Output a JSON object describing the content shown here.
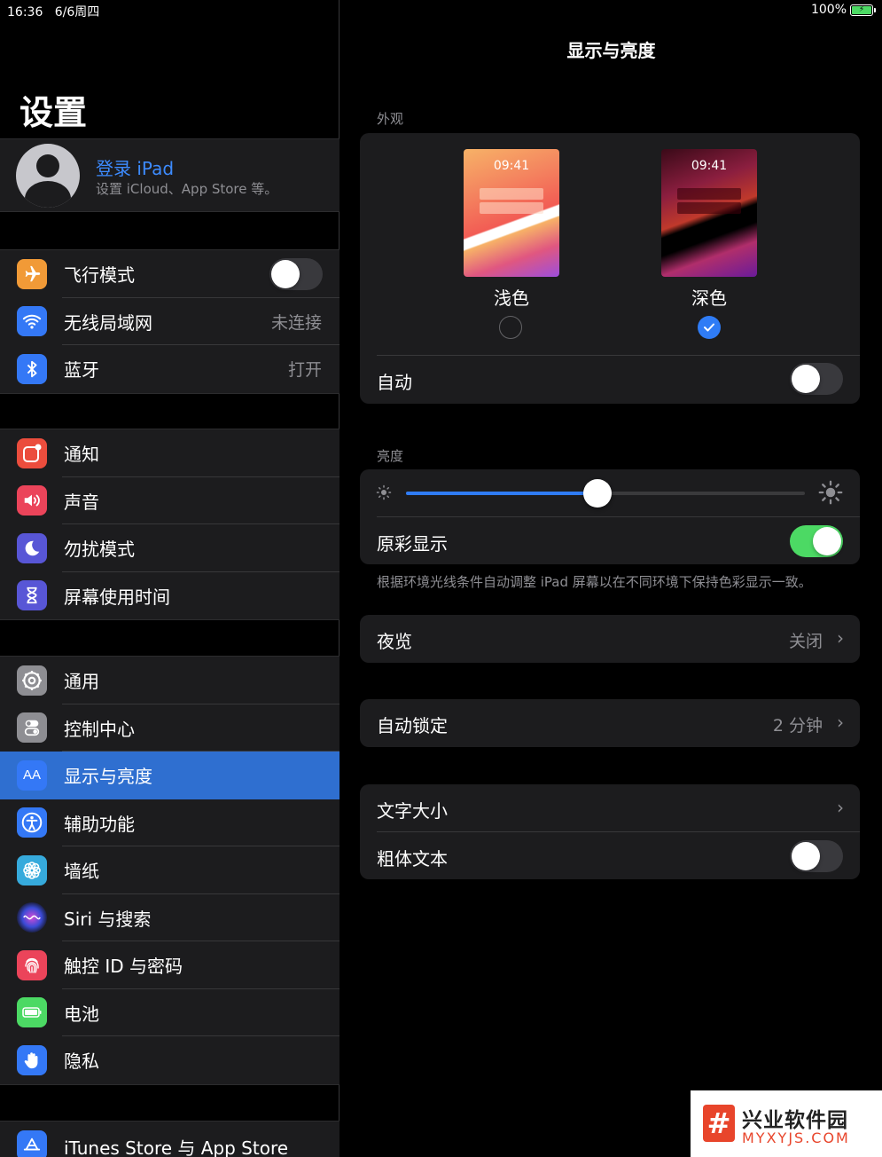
{
  "status": {
    "time": "16:36",
    "date": "6/6周四",
    "battery": "100%"
  },
  "sidebar": {
    "title": "设置",
    "profile": {
      "name": "登录 iPad",
      "subtitle": "设置 iCloud、App Store 等。"
    },
    "group1": [
      {
        "label": "飞行模式",
        "icon": "airplane-icon",
        "color": "#f19a37"
      },
      {
        "label": "无线局域网",
        "value": "未连接",
        "icon": "wifi-icon",
        "color": "#3478f6"
      },
      {
        "label": "蓝牙",
        "value": "打开",
        "icon": "bluetooth-icon",
        "color": "#3478f6"
      }
    ],
    "group2": [
      {
        "label": "通知",
        "icon": "notifications-icon",
        "color": "#eb4d3d"
      },
      {
        "label": "声音",
        "icon": "sound-icon",
        "color": "#eb445a"
      },
      {
        "label": "勿扰模式",
        "icon": "moon-icon",
        "color": "#5856d6"
      },
      {
        "label": "屏幕使用时间",
        "icon": "hourglass-icon",
        "color": "#5856d6"
      }
    ],
    "group3": [
      {
        "label": "通用",
        "icon": "gear-icon",
        "color": "#8e8e93"
      },
      {
        "label": "控制中心",
        "icon": "switches-icon",
        "color": "#8e8e93"
      },
      {
        "label": "显示与亮度",
        "icon": "text-size-icon",
        "color": "#3478f6",
        "icon_text": "AA"
      },
      {
        "label": "辅助功能",
        "icon": "accessibility-icon",
        "color": "#3478f6"
      },
      {
        "label": "墙纸",
        "icon": "flower-icon",
        "color": "#36aadc"
      },
      {
        "label": "Siri 与搜索",
        "icon": "siri-icon",
        "color": "#222"
      },
      {
        "label": "触控 ID 与密码",
        "icon": "fingerprint-icon",
        "color": "#eb445a"
      },
      {
        "label": "电池",
        "icon": "battery-icon",
        "color": "#4cd964"
      },
      {
        "label": "隐私",
        "icon": "hand-icon",
        "color": "#3478f6"
      }
    ],
    "group4": [
      {
        "label": "iTunes Store 与 App Store",
        "icon": "app-store-icon",
        "color": "#3478f6"
      }
    ]
  },
  "detail": {
    "title": "显示与亮度",
    "appearance_header": "外观",
    "light_label": "浅色",
    "dark_label": "深色",
    "thumb_time": "09:41",
    "auto_label": "自动",
    "brightness_header": "亮度",
    "brightness_level": 0.48,
    "true_tone_label": "原彩显示",
    "true_tone_note": "根据环境光线条件自动调整 iPad 屏幕以在不同环境下保持色彩显示一致。",
    "night_shift_label": "夜览",
    "night_shift_value": "关闭",
    "auto_lock_label": "自动锁定",
    "auto_lock_value": "2 分钟",
    "text_size_label": "文字大小",
    "bold_text_label": "粗体文本"
  },
  "watermark": {
    "title": "兴业软件园",
    "sub": "MYXYJS.COM"
  },
  "colors": {
    "accent": "#2f7cf6",
    "selected_row": "#2f6fd0",
    "switch_on": "#4cd964"
  }
}
